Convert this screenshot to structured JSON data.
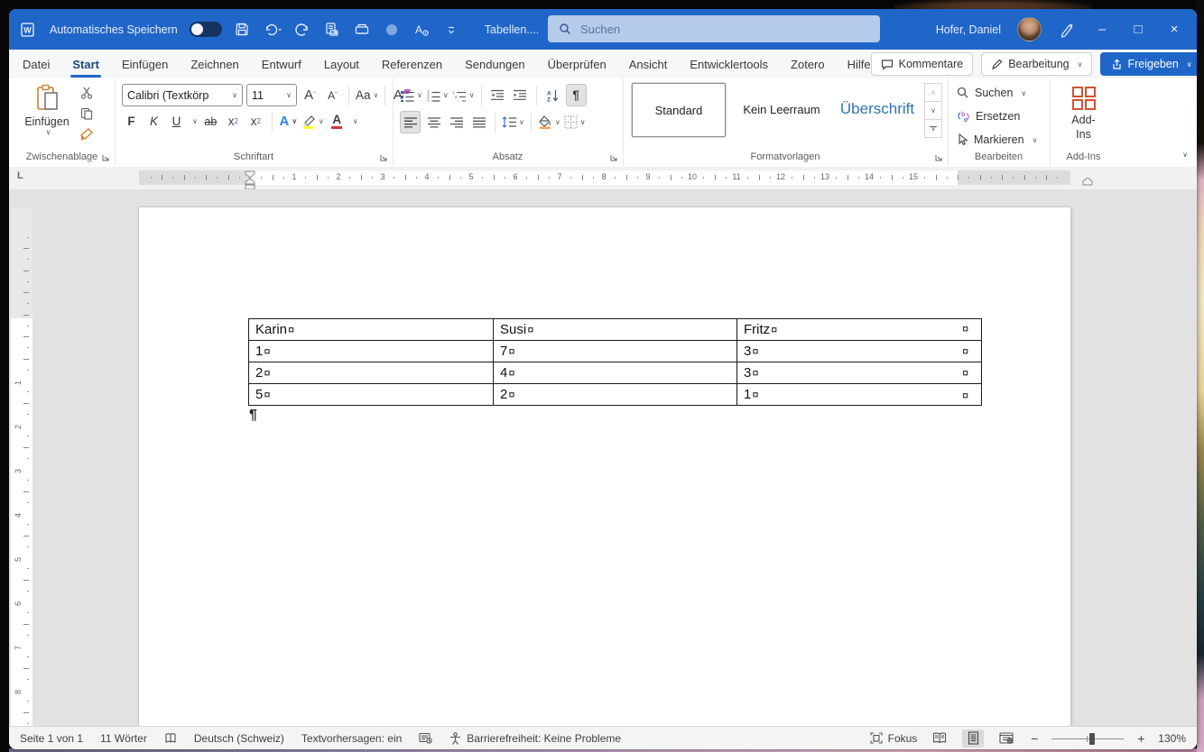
{
  "titlebar": {
    "autosave": "Automatisches Speichern",
    "doc_title": "Tabellen....",
    "search_placeholder": "Suchen",
    "user": "Hofer, Daniel"
  },
  "tabs": {
    "active": "Start",
    "items": [
      "Datei",
      "Start",
      "Einfügen",
      "Zeichnen",
      "Entwurf",
      "Layout",
      "Referenzen",
      "Sendungen",
      "Überprüfen",
      "Ansicht",
      "Entwicklertools",
      "Zotero",
      "Hilfe"
    ]
  },
  "actions": {
    "comments": "Kommentare",
    "editing": "Bearbeitung",
    "share": "Freigeben"
  },
  "ribbon": {
    "clipboard": {
      "group": "Zwischenablage",
      "paste": "Einfügen"
    },
    "font": {
      "group": "Schriftart",
      "family": "Calibri (Textkörp",
      "size": "11",
      "bold": "F",
      "italic": "K",
      "underline": "U",
      "strike": "ab",
      "case": "Aa"
    },
    "paragraph": {
      "group": "Absatz",
      "pilcrow": "¶"
    },
    "styles": {
      "group": "Formatvorlagen",
      "items": [
        "Standard",
        "Kein Leerraum",
        "Überschrift"
      ],
      "selected": "Standard"
    },
    "editing": {
      "group": "Bearbeiten",
      "find": "Suchen",
      "replace": "Ersetzen",
      "select": "Markieren"
    },
    "addins": {
      "group": "Add-Ins",
      "button_line1": "Add-",
      "button_line2": "Ins"
    }
  },
  "ruler": {
    "h_numbers": [
      1,
      2,
      3,
      4,
      5,
      6,
      7,
      8,
      9,
      10,
      11,
      12,
      13,
      14,
      15
    ],
    "v_numbers": [
      1,
      2,
      3,
      4,
      5,
      6,
      7,
      8
    ]
  },
  "doc": {
    "table": {
      "headers": [
        "Karin",
        "Susi",
        "Fritz"
      ],
      "rows": [
        [
          "1",
          "7",
          "3"
        ],
        [
          "2",
          "4",
          "3"
        ],
        [
          "5",
          "2",
          "1"
        ]
      ],
      "marker": "¤"
    },
    "pilcrow": "¶"
  },
  "status": {
    "page": "Seite 1 von 1",
    "words": "11 Wörter",
    "lang": "Deutsch (Schweiz)",
    "predict": "Textvorhersagen: ein",
    "access": "Barrierefreiheit: Keine Probleme",
    "focus": "Fokus",
    "zoom": "130%"
  },
  "colors": {
    "titlebar_blue": "#2066c9",
    "heading_blue": "#2e74b5",
    "share_blue": "#2066c9",
    "addins_red": "#d35230"
  }
}
